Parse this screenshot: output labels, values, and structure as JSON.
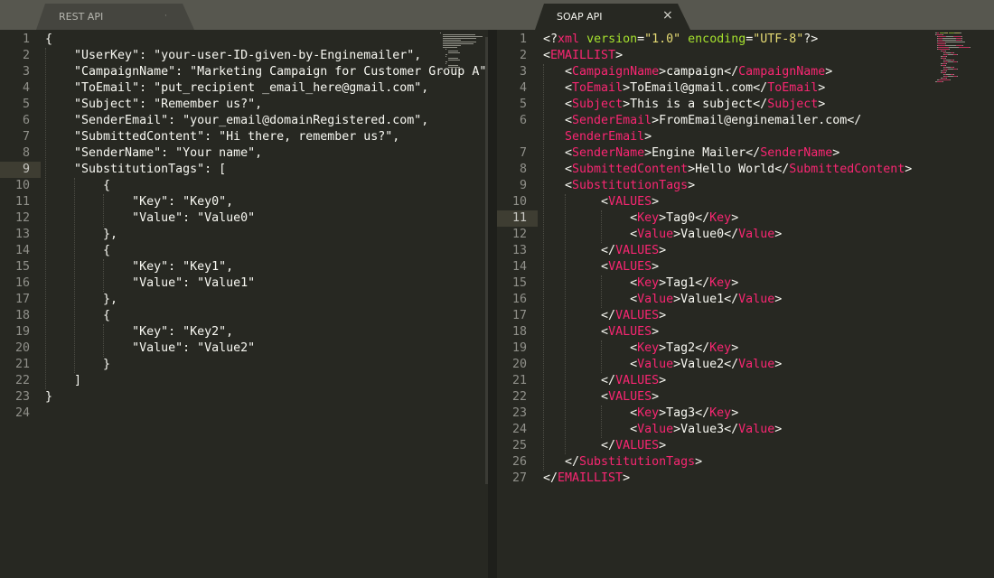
{
  "tabs": [
    {
      "label": "REST API",
      "active": false
    },
    {
      "label": "SOAP API",
      "active": true,
      "close_glyph": "×"
    }
  ],
  "left_editor": {
    "highlighted_line": 9,
    "lines": [
      [
        {
          "t": "{",
          "c": ""
        }
      ],
      [
        {
          "t": "    \"UserKey\": \"your-user-ID-given-by-Enginemailer\",",
          "c": ""
        }
      ],
      [
        {
          "t": "    \"CampaignName\": \"Marketing Campaign for Customer Group A\",",
          "c": ""
        }
      ],
      [
        {
          "t": "    \"ToEmail\": \"put_recipient _email_here@gmail.com\",",
          "c": ""
        }
      ],
      [
        {
          "t": "    \"Subject\": \"Remember us?\",",
          "c": ""
        }
      ],
      [
        {
          "t": "    \"SenderEmail\": \"your_email@domainRegistered.com\",",
          "c": ""
        }
      ],
      [
        {
          "t": "    \"SubmittedContent\": \"Hi there, remember us?\",",
          "c": ""
        }
      ],
      [
        {
          "t": "    \"SenderName\": \"Your name\",",
          "c": ""
        }
      ],
      [
        {
          "t": "    \"SubstitutionTags\": [",
          "c": ""
        }
      ],
      [
        {
          "t": "        {",
          "c": ""
        }
      ],
      [
        {
          "t": "            \"Key\": \"Key0\",",
          "c": ""
        }
      ],
      [
        {
          "t": "            \"Value\": \"Value0\"",
          "c": ""
        }
      ],
      [
        {
          "t": "        },",
          "c": ""
        }
      ],
      [
        {
          "t": "        {",
          "c": ""
        }
      ],
      [
        {
          "t": "            \"Key\": \"Key1\",",
          "c": ""
        }
      ],
      [
        {
          "t": "            \"Value\": \"Value1\"",
          "c": ""
        }
      ],
      [
        {
          "t": "        },",
          "c": ""
        }
      ],
      [
        {
          "t": "        {",
          "c": ""
        }
      ],
      [
        {
          "t": "            \"Key\": \"Key2\",",
          "c": ""
        }
      ],
      [
        {
          "t": "            \"Value\": \"Value2\"",
          "c": ""
        }
      ],
      [
        {
          "t": "        }",
          "c": ""
        }
      ],
      [
        {
          "t": "    ]",
          "c": ""
        }
      ],
      [
        {
          "t": "}",
          "c": ""
        }
      ],
      []
    ]
  },
  "right_editor": {
    "highlighted_line": 11,
    "lines": [
      [
        {
          "t": "<?",
          "c": ""
        },
        {
          "t": "xml",
          "c": "t"
        },
        {
          "t": " ",
          "c": ""
        },
        {
          "t": "version",
          "c": "a"
        },
        {
          "t": "=",
          "c": ""
        },
        {
          "t": "\"1.0\"",
          "c": "s"
        },
        {
          "t": " ",
          "c": ""
        },
        {
          "t": "encoding",
          "c": "a"
        },
        {
          "t": "=",
          "c": ""
        },
        {
          "t": "\"UTF-8\"",
          "c": "s"
        },
        {
          "t": "?>",
          "c": ""
        }
      ],
      [
        {
          "t": "<",
          "c": ""
        },
        {
          "t": "EMAILLIST",
          "c": "t"
        },
        {
          "t": ">",
          "c": ""
        }
      ],
      [
        {
          "t": "   <",
          "c": ""
        },
        {
          "t": "CampaignName",
          "c": "t"
        },
        {
          "t": ">campaign</",
          "c": ""
        },
        {
          "t": "CampaignName",
          "c": "t"
        },
        {
          "t": ">",
          "c": ""
        }
      ],
      [
        {
          "t": "   <",
          "c": ""
        },
        {
          "t": "ToEmail",
          "c": "t"
        },
        {
          "t": ">ToEmail@gmail.com</",
          "c": ""
        },
        {
          "t": "ToEmail",
          "c": "t"
        },
        {
          "t": ">",
          "c": ""
        }
      ],
      [
        {
          "t": "   <",
          "c": ""
        },
        {
          "t": "Subject",
          "c": "t"
        },
        {
          "t": ">This is a subject</",
          "c": ""
        },
        {
          "t": "Subject",
          "c": "t"
        },
        {
          "t": ">",
          "c": ""
        }
      ],
      [
        {
          "t": "   <",
          "c": ""
        },
        {
          "t": "SenderEmail",
          "c": "t"
        },
        {
          "t": ">FromEmail@enginemailer.com</",
          "c": ""
        }
      ],
      [
        {
          "t": "   ",
          "c": ""
        },
        {
          "t": "SenderEmail",
          "c": "t"
        },
        {
          "t": ">",
          "c": ""
        }
      ],
      [
        {
          "t": "   <",
          "c": ""
        },
        {
          "t": "SenderName",
          "c": "t"
        },
        {
          "t": ">Engine Mailer</",
          "c": ""
        },
        {
          "t": "SenderName",
          "c": "t"
        },
        {
          "t": ">",
          "c": ""
        }
      ],
      [
        {
          "t": "   <",
          "c": ""
        },
        {
          "t": "SubmittedContent",
          "c": "t"
        },
        {
          "t": ">Hello World</",
          "c": ""
        },
        {
          "t": "SubmittedContent",
          "c": "t"
        },
        {
          "t": ">",
          "c": ""
        }
      ],
      [
        {
          "t": "   <",
          "c": ""
        },
        {
          "t": "SubstitutionTags",
          "c": "t"
        },
        {
          "t": ">",
          "c": ""
        }
      ],
      [
        {
          "t": "        <",
          "c": ""
        },
        {
          "t": "VALUES",
          "c": "t"
        },
        {
          "t": ">",
          "c": ""
        }
      ],
      [
        {
          "t": "            <",
          "c": ""
        },
        {
          "t": "Key",
          "c": "t"
        },
        {
          "t": ">Tag0</",
          "c": ""
        },
        {
          "t": "Key",
          "c": "t"
        },
        {
          "t": ">",
          "c": ""
        }
      ],
      [
        {
          "t": "            <",
          "c": ""
        },
        {
          "t": "Value",
          "c": "t"
        },
        {
          "t": ">Value0</",
          "c": ""
        },
        {
          "t": "Value",
          "c": "t"
        },
        {
          "t": ">",
          "c": ""
        }
      ],
      [
        {
          "t": "        </",
          "c": ""
        },
        {
          "t": "VALUES",
          "c": "t"
        },
        {
          "t": ">",
          "c": ""
        }
      ],
      [
        {
          "t": "        <",
          "c": ""
        },
        {
          "t": "VALUES",
          "c": "t"
        },
        {
          "t": ">",
          "c": ""
        }
      ],
      [
        {
          "t": "            <",
          "c": ""
        },
        {
          "t": "Key",
          "c": "t"
        },
        {
          "t": ">Tag1</",
          "c": ""
        },
        {
          "t": "Key",
          "c": "t"
        },
        {
          "t": ">",
          "c": ""
        }
      ],
      [
        {
          "t": "            <",
          "c": ""
        },
        {
          "t": "Value",
          "c": "t"
        },
        {
          "t": ">Value1</",
          "c": ""
        },
        {
          "t": "Value",
          "c": "t"
        },
        {
          "t": ">",
          "c": ""
        }
      ],
      [
        {
          "t": "        </",
          "c": ""
        },
        {
          "t": "VALUES",
          "c": "t"
        },
        {
          "t": ">",
          "c": ""
        }
      ],
      [
        {
          "t": "        <",
          "c": ""
        },
        {
          "t": "VALUES",
          "c": "t"
        },
        {
          "t": ">",
          "c": ""
        }
      ],
      [
        {
          "t": "            <",
          "c": ""
        },
        {
          "t": "Key",
          "c": "t"
        },
        {
          "t": ">Tag2</",
          "c": ""
        },
        {
          "t": "Key",
          "c": "t"
        },
        {
          "t": ">",
          "c": ""
        }
      ],
      [
        {
          "t": "            <",
          "c": ""
        },
        {
          "t": "Value",
          "c": "t"
        },
        {
          "t": ">Value2</",
          "c": ""
        },
        {
          "t": "Value",
          "c": "t"
        },
        {
          "t": ">",
          "c": ""
        }
      ],
      [
        {
          "t": "        </",
          "c": ""
        },
        {
          "t": "VALUES",
          "c": "t"
        },
        {
          "t": ">",
          "c": ""
        }
      ],
      [
        {
          "t": "        <",
          "c": ""
        },
        {
          "t": "VALUES",
          "c": "t"
        },
        {
          "t": ">",
          "c": ""
        }
      ],
      [
        {
          "t": "            <",
          "c": ""
        },
        {
          "t": "Key",
          "c": "t"
        },
        {
          "t": ">Tag3</",
          "c": ""
        },
        {
          "t": "Key",
          "c": "t"
        },
        {
          "t": ">",
          "c": ""
        }
      ],
      [
        {
          "t": "            <",
          "c": ""
        },
        {
          "t": "Value",
          "c": "t"
        },
        {
          "t": ">Value3</",
          "c": ""
        },
        {
          "t": "Value",
          "c": "t"
        },
        {
          "t": ">",
          "c": ""
        }
      ],
      [
        {
          "t": "        </",
          "c": ""
        },
        {
          "t": "VALUES",
          "c": "t"
        },
        {
          "t": ">",
          "c": ""
        }
      ],
      [
        {
          "t": "   </",
          "c": ""
        },
        {
          "t": "SubstitutionTags",
          "c": "t"
        },
        {
          "t": ">",
          "c": ""
        }
      ],
      [
        {
          "t": "</",
          "c": ""
        },
        {
          "t": "EMAILLIST",
          "c": "t"
        },
        {
          "t": ">",
          "c": ""
        }
      ]
    ],
    "line_numbers": [
      "1",
      "2",
      "3",
      "4",
      "5",
      "6",
      "",
      "7",
      "8",
      "9",
      "10",
      "11",
      "12",
      "13",
      "14",
      "15",
      "16",
      "17",
      "18",
      "19",
      "20",
      "21",
      "22",
      "23",
      "24",
      "25",
      "26",
      "27"
    ]
  },
  "colors": {
    "tag": "#f92672",
    "attr": "#a6e22e",
    "string": "#e6db74",
    "text": "#f8f8f2",
    "background": "#272822"
  }
}
